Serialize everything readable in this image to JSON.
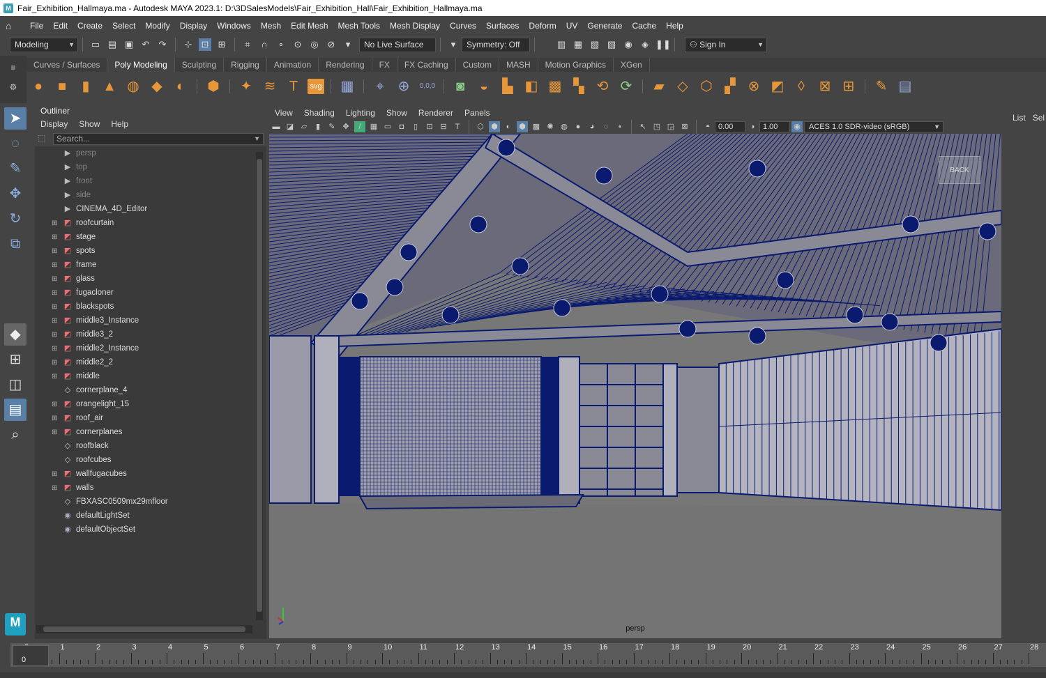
{
  "window": {
    "title": "Fair_Exhibition_Hallmaya.ma - Autodesk MAYA 2023.1: D:\\3DSalesModels\\Fair_Exhibition_Hall\\Fair_Exhibition_Hallmaya.ma"
  },
  "menubar": {
    "items": [
      "File",
      "Edit",
      "Create",
      "Select",
      "Modify",
      "Display",
      "Windows",
      "Mesh",
      "Edit Mesh",
      "Mesh Tools",
      "Mesh Display",
      "Curves",
      "Surfaces",
      "Deform",
      "UV",
      "Generate",
      "Cache",
      "Help"
    ]
  },
  "statusline": {
    "mode": "Modeling",
    "live_surface": "No Live Surface",
    "symmetry": "Symmetry: Off",
    "sign_in": "Sign In"
  },
  "shelf": {
    "tabs": [
      "Curves / Surfaces",
      "Poly Modeling",
      "Sculpting",
      "Rigging",
      "Animation",
      "Rendering",
      "FX",
      "FX Caching",
      "Custom",
      "MASH",
      "Motion Graphics",
      "XGen"
    ],
    "active_tab": "Poly Modeling",
    "svg_label": "svg",
    "coord_label": "0,0,0"
  },
  "outliner": {
    "title": "Outliner",
    "menus": [
      "Display",
      "Show",
      "Help"
    ],
    "search_placeholder": "Search...",
    "items": [
      {
        "label": "persp",
        "icon": "camera-icon",
        "expandable": false,
        "dim": true
      },
      {
        "label": "top",
        "icon": "camera-icon",
        "expandable": false,
        "dim": true
      },
      {
        "label": "front",
        "icon": "camera-icon",
        "expandable": false,
        "dim": true
      },
      {
        "label": "side",
        "icon": "camera-icon",
        "expandable": false,
        "dim": true
      },
      {
        "label": "CINEMA_4D_Editor",
        "icon": "camera-icon",
        "expandable": false,
        "dim": false
      },
      {
        "label": "roofcurtain",
        "icon": "group-icon",
        "expandable": true,
        "dim": false
      },
      {
        "label": "stage",
        "icon": "group-icon",
        "expandable": true,
        "dim": false
      },
      {
        "label": "spots",
        "icon": "group-icon",
        "expandable": true,
        "dim": false
      },
      {
        "label": "frame",
        "icon": "group-icon",
        "expandable": true,
        "dim": false
      },
      {
        "label": "glass",
        "icon": "group-icon",
        "expandable": true,
        "dim": false
      },
      {
        "label": "fugacloner",
        "icon": "group-icon",
        "expandable": true,
        "dim": false
      },
      {
        "label": "blackspots",
        "icon": "group-icon",
        "expandable": true,
        "dim": false
      },
      {
        "label": "middle3_Instance",
        "icon": "group-icon",
        "expandable": true,
        "dim": false
      },
      {
        "label": "middle3_2",
        "icon": "group-icon",
        "expandable": true,
        "dim": false
      },
      {
        "label": "middle2_Instance",
        "icon": "group-icon",
        "expandable": true,
        "dim": false
      },
      {
        "label": "middle2_2",
        "icon": "group-icon",
        "expandable": true,
        "dim": false
      },
      {
        "label": "middle",
        "icon": "group-icon",
        "expandable": true,
        "dim": false
      },
      {
        "label": "cornerplane_4",
        "icon": "mesh-icon",
        "expandable": false,
        "dim": false
      },
      {
        "label": "orangelight_15",
        "icon": "group-icon",
        "expandable": true,
        "dim": false
      },
      {
        "label": "roof_air",
        "icon": "group-icon",
        "expandable": true,
        "dim": false
      },
      {
        "label": "cornerplanes",
        "icon": "group-icon",
        "expandable": true,
        "dim": false
      },
      {
        "label": "roofblack",
        "icon": "mesh-icon",
        "expandable": false,
        "dim": false
      },
      {
        "label": "roofcubes",
        "icon": "mesh-icon",
        "expandable": false,
        "dim": false
      },
      {
        "label": "wallfugacubes",
        "icon": "group-icon",
        "expandable": true,
        "dim": false
      },
      {
        "label": "walls",
        "icon": "group-icon",
        "expandable": true,
        "dim": false
      },
      {
        "label": "FBXASC0509mx29mfloor",
        "icon": "mesh-icon",
        "expandable": false,
        "dim": false
      },
      {
        "label": "defaultLightSet",
        "icon": "set-icon",
        "expandable": false,
        "dim": false
      },
      {
        "label": "defaultObjectSet",
        "icon": "set-icon",
        "expandable": false,
        "dim": false
      }
    ]
  },
  "viewport": {
    "menus": [
      "View",
      "Shading",
      "Lighting",
      "Show",
      "Renderer",
      "Panels"
    ],
    "exposure": "0.00",
    "gamma": "1.00",
    "colorspace": "ACES 1.0 SDR-video (sRGB)",
    "camera": "persp",
    "viewcube_label": "BACK"
  },
  "rightpanel": {
    "items": [
      "List",
      "Sel"
    ]
  },
  "timeline": {
    "labels": [
      "0",
      "1",
      "2",
      "3",
      "4",
      "5",
      "6",
      "7",
      "8",
      "9",
      "10",
      "11",
      "12",
      "13",
      "14",
      "15",
      "16",
      "17",
      "18",
      "19",
      "20",
      "21",
      "22",
      "23",
      "24",
      "25",
      "26",
      "27",
      "28"
    ],
    "current_frame": "0"
  },
  "colors": {
    "accent": "#5a7fa6",
    "wire": "#0a1a6e",
    "mesh_fill": "#8c8c9a",
    "shelf_icon": "#e8963a"
  }
}
